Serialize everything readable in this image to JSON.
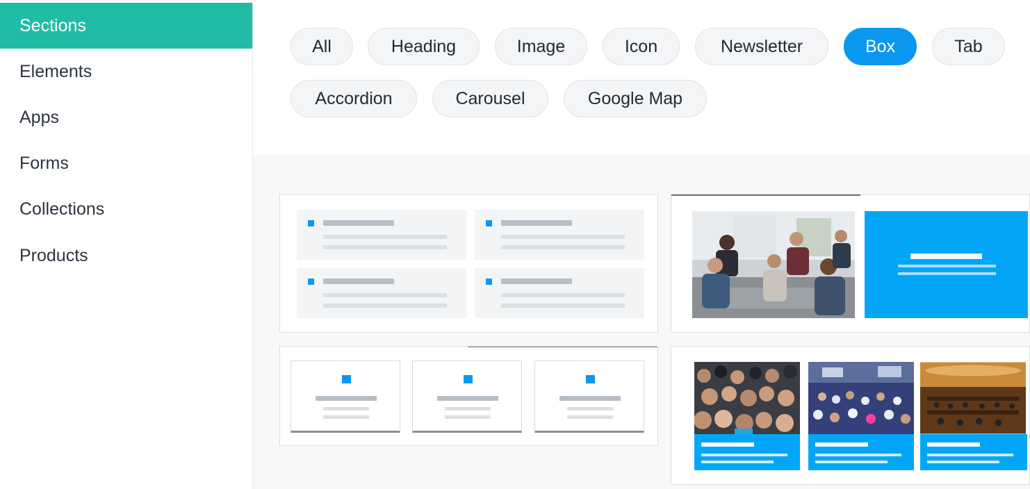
{
  "sidebar": {
    "items": [
      {
        "label": "Sections",
        "active": true
      },
      {
        "label": "Elements",
        "active": false
      },
      {
        "label": "Apps",
        "active": false
      },
      {
        "label": "Forms",
        "active": false
      },
      {
        "label": "Collections",
        "active": false
      },
      {
        "label": "Products",
        "active": false
      }
    ]
  },
  "filters": {
    "chips": [
      {
        "label": "All",
        "active": false
      },
      {
        "label": "Heading",
        "active": false
      },
      {
        "label": "Image",
        "active": false
      },
      {
        "label": "Icon",
        "active": false
      },
      {
        "label": "Newsletter",
        "active": false
      },
      {
        "label": "Box",
        "active": true
      },
      {
        "label": "Tab",
        "active": false
      },
      {
        "label": "Accordion",
        "active": false
      },
      {
        "label": "Carousel",
        "active": false
      },
      {
        "label": "Google Map",
        "active": false
      }
    ]
  },
  "colors": {
    "sidebar_active": "#21bca5",
    "chip_active": "#0a98f0",
    "box_blue": "#03a6f7",
    "content_bg": "#f7f8f8"
  },
  "templates": {
    "cards": [
      {
        "name": "feature-grid-2x2"
      },
      {
        "name": "image-with-blue-box"
      },
      {
        "name": "three-icon-boxes"
      },
      {
        "name": "three-photo-columns"
      }
    ]
  }
}
